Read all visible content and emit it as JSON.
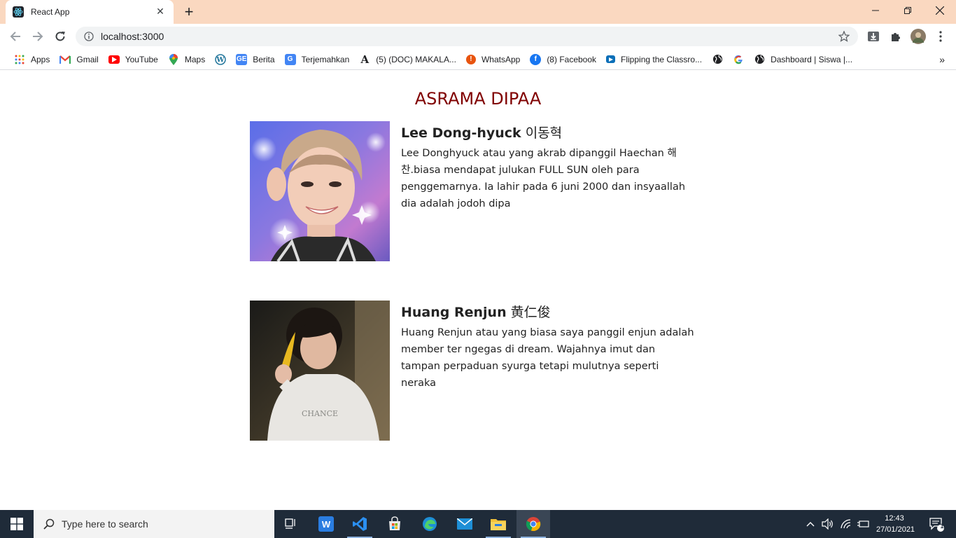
{
  "browser": {
    "tab_title": "React App",
    "url": "localhost:3000"
  },
  "bookmarks": [
    {
      "label": "Apps",
      "icon": "apps-grid-icon",
      "color": "#4285f4"
    },
    {
      "label": "Gmail",
      "icon": "gmail-icon",
      "color": "#ea4335"
    },
    {
      "label": "YouTube",
      "icon": "youtube-icon",
      "color": "#ff0000"
    },
    {
      "label": "Maps",
      "icon": "maps-pin-icon",
      "color": "#34a853"
    },
    {
      "label": "",
      "icon": "wordpress-icon",
      "color": "#21759b"
    },
    {
      "label": "Berita",
      "icon": "google-news-icon",
      "color": "#4285f4"
    },
    {
      "label": "Terjemahkan",
      "icon": "google-translate-icon",
      "color": "#4285f4"
    },
    {
      "label": "(5) (DOC) MAKALA...",
      "icon": "academia-icon",
      "color": "#202124"
    },
    {
      "label": "WhatsApp",
      "icon": "whatsapp-icon",
      "color": "#e8540f"
    },
    {
      "label": "(8) Facebook",
      "icon": "facebook-icon",
      "color": "#1877f2"
    },
    {
      "label": "Flipping the Classro...",
      "icon": "video-play-icon",
      "color": "#0b6fb8"
    },
    {
      "label": "",
      "icon": "globe-icon",
      "color": "#202124"
    },
    {
      "label": "",
      "icon": "google-icon",
      "color": "#4285f4"
    },
    {
      "label": "Dashboard | Siswa |...",
      "icon": "globe-icon",
      "color": "#202124"
    }
  ],
  "page": {
    "title": "ASRAMA DIPAA",
    "title_color": "#800000",
    "members": [
      {
        "name": "Lee Dong-hyuck",
        "native_name": "이동혁",
        "description": "Lee Donghyuck atau yang akrab dipanggil Haechan 해찬.biasa mendapat julukan FULL SUN oleh para penggemarnya. Ia lahir pada 6 juni 2000 dan insyaallah dia adalah jodoh dipa"
      },
      {
        "name": "Huang Renjun",
        "native_name": "黄仁俊",
        "description": "Huang Renjun atau yang biasa saya panggil enjun adalah member ter ngegas di dream. Wajahnya imut dan tampan perpaduan syurga tetapi mulutnya seperti neraka"
      }
    ]
  },
  "taskbar": {
    "search_placeholder": "Type here to search",
    "time": "12:43",
    "date": "27/01/2021",
    "notification_count": "1"
  }
}
